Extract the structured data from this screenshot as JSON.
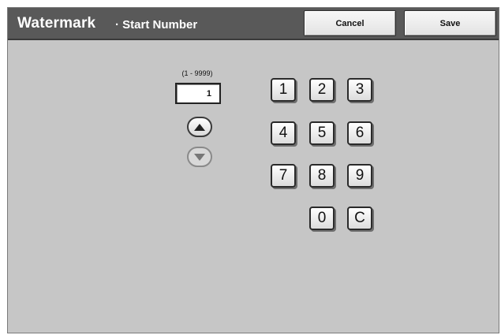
{
  "header": {
    "title": "Watermark",
    "subtitle": "· Start Number",
    "cancel_label": "Cancel",
    "save_label": "Save"
  },
  "start_number": {
    "range": "(1 - 9999)",
    "value": "1"
  },
  "keypad": {
    "k1": "1",
    "k2": "2",
    "k3": "3",
    "k4": "4",
    "k5": "5",
    "k6": "6",
    "k7": "7",
    "k8": "8",
    "k9": "9",
    "k0": "0",
    "clear": "C"
  },
  "icons": {
    "up": "triangle-up-icon",
    "down": "triangle-down-icon"
  },
  "colors": {
    "title_bar": "#595959",
    "panel": "#c6c6c6"
  }
}
